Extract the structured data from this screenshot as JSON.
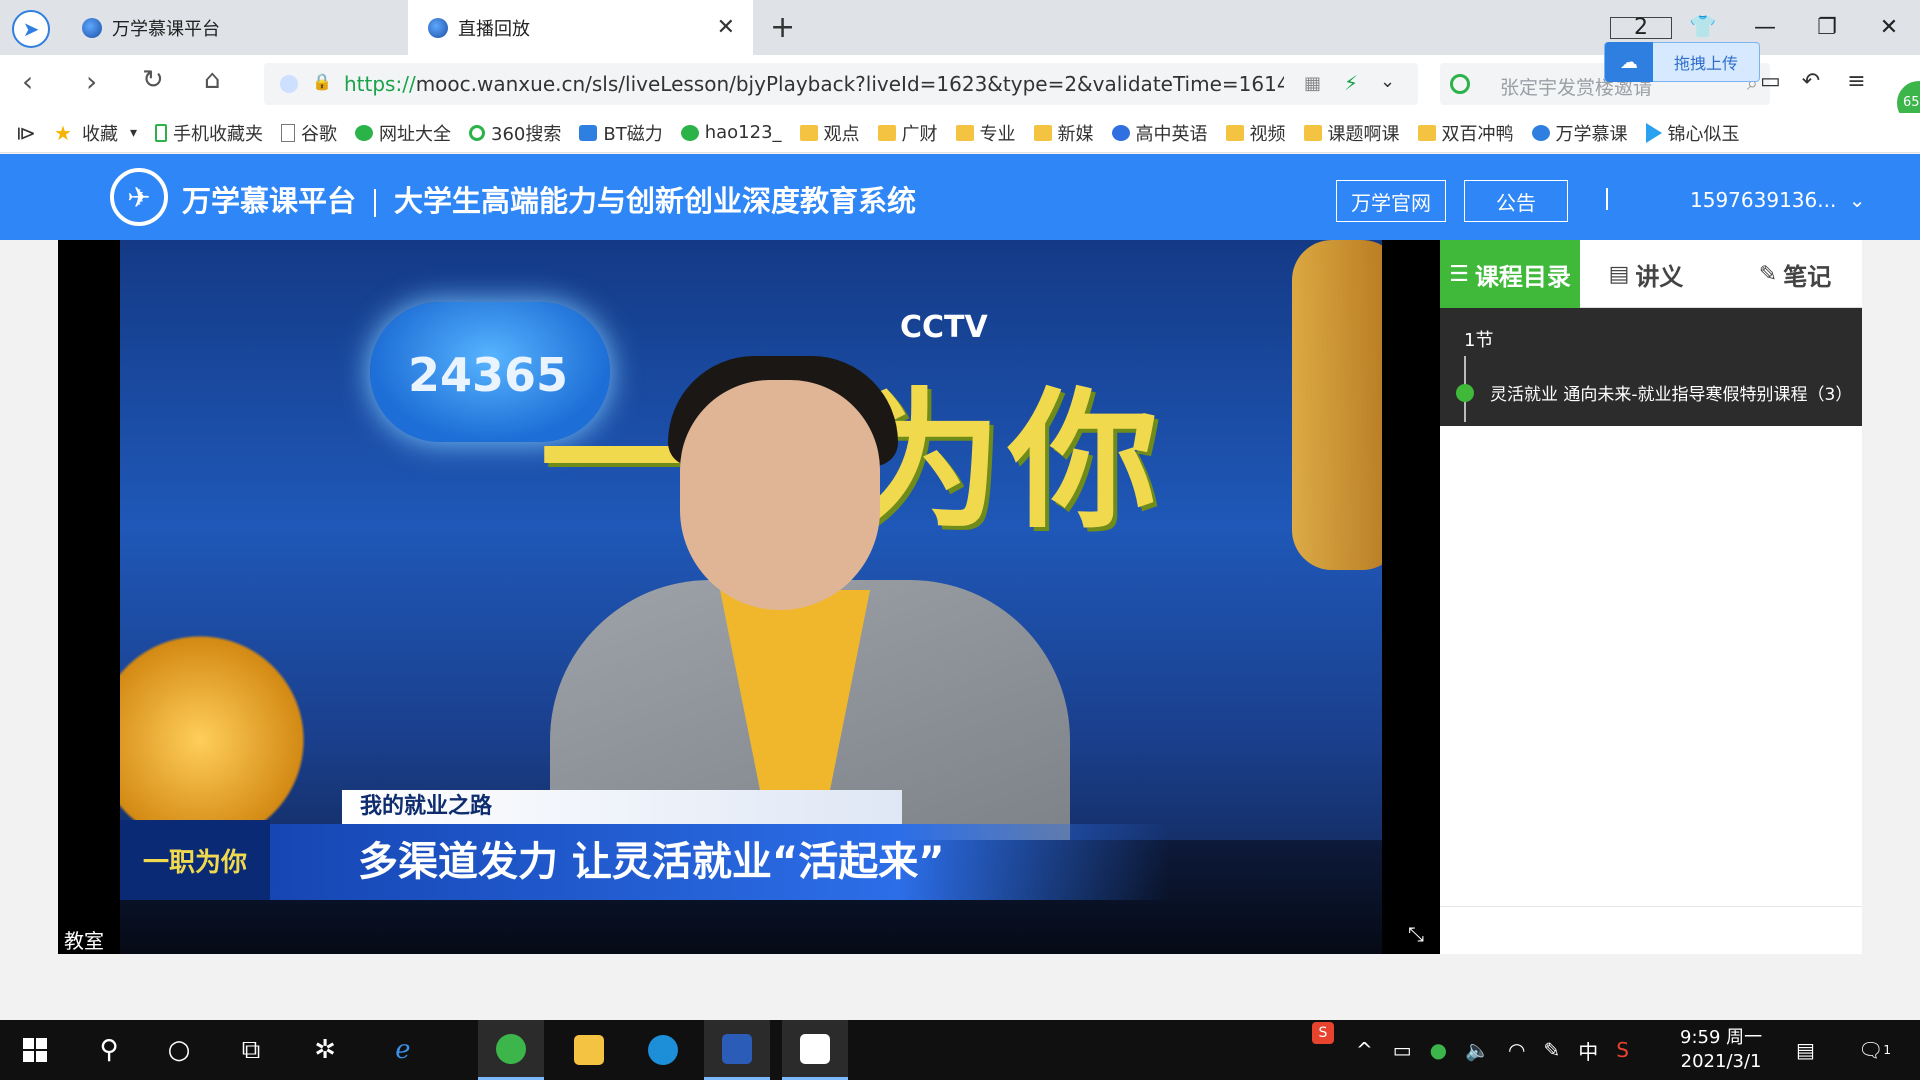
{
  "browser": {
    "tabs": [
      {
        "title": "万学慕课平台"
      },
      {
        "title": "直播回放"
      }
    ],
    "window_badge": "2",
    "upload_button": "拖拽上传",
    "url_protocol": "https://",
    "url_rest": "mooc.wanxue.cn/sls/liveLesson/bjyPlayback?liveId=1623&type=2&validateTime=1614",
    "search_placeholder": "张定宇发赏楼邀请",
    "side_badge": "65",
    "bookmarks": [
      {
        "label": "收藏",
        "icon": "star-icon"
      },
      {
        "label": "手机收藏夹",
        "icon": "phone-icon"
      },
      {
        "label": "谷歌",
        "icon": "document-icon"
      },
      {
        "label": "网址大全",
        "icon": "globe-icon"
      },
      {
        "label": "360搜索",
        "icon": "360-icon"
      },
      {
        "label": "BT磁力",
        "icon": "bt-icon"
      },
      {
        "label": "hao123_",
        "icon": "hao123-icon"
      },
      {
        "label": "观点",
        "icon": "folder-icon"
      },
      {
        "label": "广财",
        "icon": "folder-icon"
      },
      {
        "label": "专业",
        "icon": "folder-icon"
      },
      {
        "label": "新媒",
        "icon": "folder-icon"
      },
      {
        "label": "高中英语",
        "icon": "baidu-paw-icon"
      },
      {
        "label": "视频",
        "icon": "folder-icon"
      },
      {
        "label": "课题啊课",
        "icon": "folder-icon"
      },
      {
        "label": "双百冲鸭",
        "icon": "folder-icon"
      },
      {
        "label": "万学慕课",
        "icon": "wanxue-icon"
      },
      {
        "label": "锦心似玉",
        "icon": "play-icon"
      }
    ]
  },
  "site": {
    "brand": "万学慕课平台",
    "subtitle": "大学生高端能力与创新创业深度教育系统",
    "official_button": "万学官网",
    "notice_button": "公告",
    "user": "1597639136..."
  },
  "video": {
    "bug_number": "24365",
    "channel_mark": "CCTV",
    "show_title": "一职为你",
    "caption_small": "我的就业之路",
    "caption_main": "多渠道发力 让灵活就业“活起来”",
    "caption_logo": "一职为你",
    "room_label": "教室"
  },
  "panel": {
    "tabs": [
      "课程目录",
      "讲义",
      "笔记"
    ],
    "chapter": "1节",
    "lesson_title": "灵活就业 通向未来-就业指导寒假特别课程（3）"
  },
  "taskbar": {
    "time": "9:59 周一",
    "date": "2021/3/1",
    "ime": "中",
    "notification_count": "1"
  },
  "colors": {
    "site_header": "#2f86f6",
    "active_tab": "#40b93b",
    "taskbar": "#101010"
  }
}
